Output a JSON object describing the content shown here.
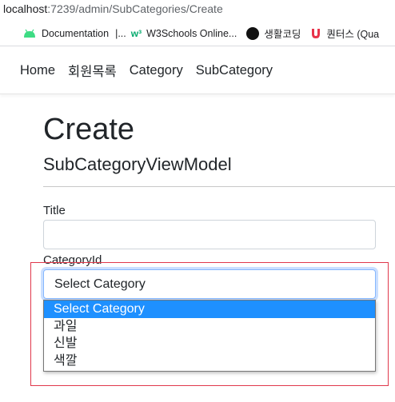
{
  "browser": {
    "url_host": "localhost",
    "url_path": ":7239/admin/SubCategories/Create",
    "bookmarks": [
      {
        "label": "Documentation",
        "icon": "android-icon"
      },
      {
        "label": "W3Schools Online...",
        "icon": "w3schools-icon"
      },
      {
        "label": "생활코딩",
        "icon": "circle-icon"
      },
      {
        "label": "퀀터스 (Qua",
        "icon": "magnet-icon"
      }
    ],
    "bookmark_separator": "|...",
    "w3_icon_text": "w³"
  },
  "nav": {
    "links": [
      "Home",
      "회원목록",
      "Category",
      "SubCategory"
    ]
  },
  "page": {
    "title": "Create",
    "subtitle": "SubCategoryViewModel"
  },
  "form": {
    "title_label": "Title",
    "title_value": "",
    "category_label": "CategoryId",
    "category_selected": "Select Category",
    "category_options": [
      "Select Category",
      "과일",
      "신발",
      "색깔"
    ]
  },
  "colors": {
    "option_highlight": "#1e90ff",
    "focus_border": "#86b7fe",
    "annotation_box": "#e0384b"
  }
}
